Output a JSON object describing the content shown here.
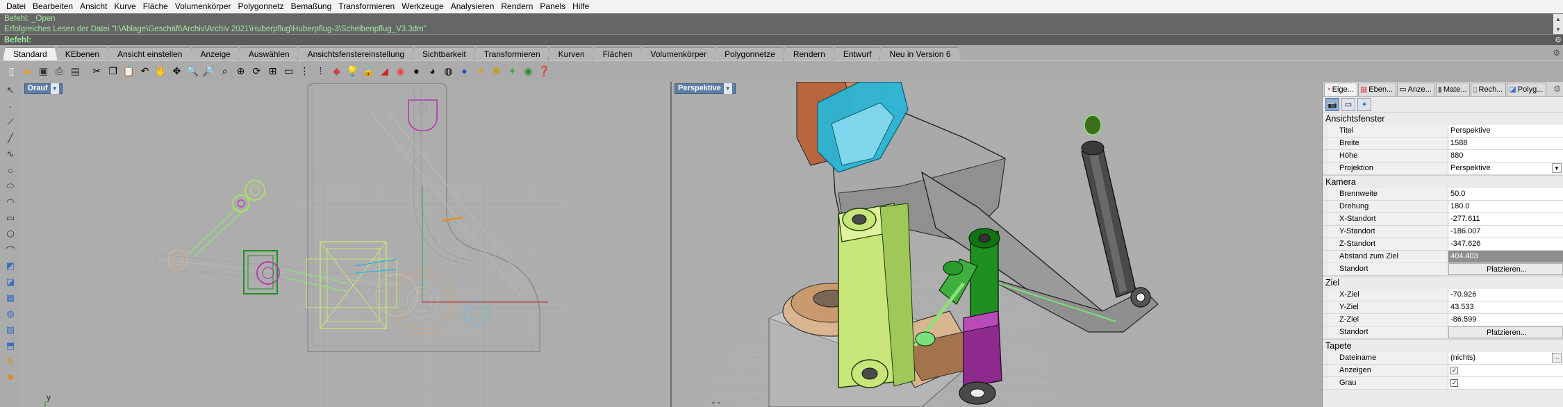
{
  "menu": [
    "Datei",
    "Bearbeiten",
    "Ansicht",
    "Kurve",
    "Fläche",
    "Volumenkörper",
    "Polygonnetz",
    "Bemaßung",
    "Transformieren",
    "Werkzeuge",
    "Analysieren",
    "Rendern",
    "Panels",
    "Hilfe"
  ],
  "command_history": [
    "Befehl: _Open",
    "Erfolgreiches Lesen der Datei \"I:\\Ablage\\Geschäft\\Archiv\\Archiv 2021\\Huberpflug\\Huberpflug-3\\Scheibenpflug_V3.3dm\""
  ],
  "command_prompt": "Befehl:",
  "tabs": [
    "Standard",
    "KEbenen",
    "Ansicht einstellen",
    "Anzeige",
    "Auswählen",
    "Ansichtsfenstereinstellung",
    "Sichtbarkeit",
    "Transformieren",
    "Kurven",
    "Flächen",
    "Volumenkörper",
    "Polygonnetze",
    "Rendern",
    "Entwurf",
    "Neu in Version 6"
  ],
  "active_tab": "Standard",
  "viewports": {
    "top": {
      "title": "Drauf",
      "axis_label": "y"
    },
    "perspective": {
      "title": "Perspektive"
    }
  },
  "panel": {
    "tabs": [
      {
        "label": "Eige...",
        "icon": "properties-icon"
      },
      {
        "label": "Eben...",
        "icon": "layers-icon"
      },
      {
        "label": "Anze...",
        "icon": "display-icon"
      },
      {
        "label": "Mate...",
        "icon": "materials-icon"
      },
      {
        "label": "Rech...",
        "icon": "render-icon"
      },
      {
        "label": "Polyg...",
        "icon": "polygon-icon"
      }
    ],
    "sections": {
      "ansichtsfenster": {
        "heading": "Ansichtsfenster",
        "titel_k": "Titel",
        "titel_v": "Perspektive",
        "breite_k": "Breite",
        "breite_v": "1588",
        "hoehe_k": "Höhe",
        "hoehe_v": "880",
        "projektion_k": "Projektion",
        "projektion_v": "Perspektive"
      },
      "kamera": {
        "heading": "Kamera",
        "brennweite_k": "Brennweite",
        "brennweite_v": "50.0",
        "drehung_k": "Drehung",
        "drehung_v": "180.0",
        "x_k": "X-Standort",
        "x_v": "-277.611",
        "y_k": "Y-Standort",
        "y_v": "-186.007",
        "z_k": "Z-Standort",
        "z_v": "-347.626",
        "abstand_k": "Abstand zum Ziel",
        "abstand_v": "404.403",
        "standort_k": "Standort",
        "standort_v": "Platzieren..."
      },
      "ziel": {
        "heading": "Ziel",
        "x_k": "X-Ziel",
        "x_v": "-70.926",
        "y_k": "Y-Ziel",
        "y_v": "43.533",
        "z_k": "Z-Ziel",
        "z_v": "-86.599",
        "standort_k": "Standort",
        "standort_v": "Platzieren..."
      },
      "tapete": {
        "heading": "Tapete",
        "datei_k": "Dateiname",
        "datei_v": "(nichts)",
        "anzeigen_k": "Anzeigen",
        "grau_k": "Grau"
      }
    }
  },
  "colors": {
    "model_lime": "#c8e67a",
    "model_green": "#1f8f1f",
    "model_cyan": "#2bb6d6",
    "model_orange": "#b9653d",
    "model_purple": "#8e2a8e",
    "model_tan": "#d9b590",
    "model_gray": "#a9a9a9",
    "viewport_title": "#5f7ea5"
  }
}
